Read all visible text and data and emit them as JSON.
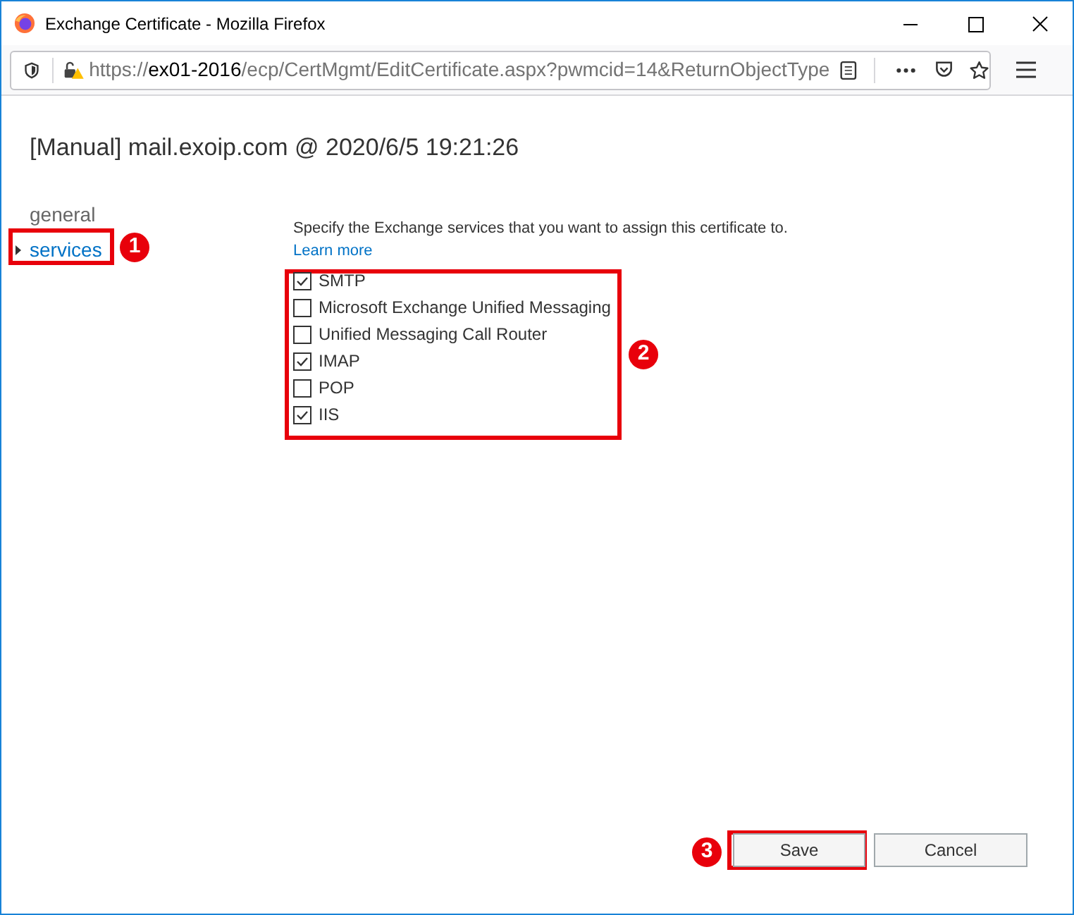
{
  "window": {
    "title": "Exchange Certificate - Mozilla Firefox"
  },
  "address_bar": {
    "url_prefix": "https://",
    "host": "ex01-2016",
    "path": "/ecp/CertMgmt/EditCertificate.aspx?pwmcid=14&ReturnObjectType"
  },
  "page_title": "[Manual] mail.exoip.com @ 2020/6/5 19:21:26",
  "nav": [
    {
      "label": "general",
      "selected": false
    },
    {
      "label": "services",
      "selected": true
    }
  ],
  "description": {
    "text": "Specify the Exchange services that you want to assign this certificate to.",
    "link": "Learn more"
  },
  "services": [
    {
      "label": "SMTP",
      "checked": true
    },
    {
      "label": "Microsoft Exchange Unified Messaging",
      "checked": false
    },
    {
      "label": "Unified Messaging Call Router",
      "checked": false
    },
    {
      "label": "IMAP",
      "checked": true
    },
    {
      "label": "POP",
      "checked": false
    },
    {
      "label": "IIS",
      "checked": true
    }
  ],
  "buttons": [
    {
      "label": "Save",
      "kind": "primary"
    },
    {
      "label": "Cancel",
      "kind": "secondary"
    }
  ],
  "annotations": [
    {
      "number": "1"
    },
    {
      "number": "2"
    },
    {
      "number": "3"
    }
  ]
}
